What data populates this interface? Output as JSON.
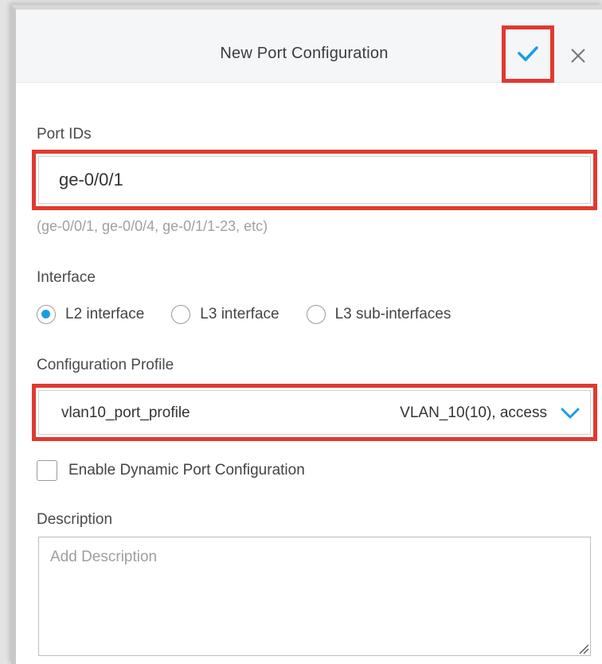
{
  "dialog": {
    "title": "New Port Configuration"
  },
  "port_ids": {
    "label": "Port IDs",
    "value": "ge-0/0/1",
    "hint": "(ge-0/0/1, ge-0/0/4, ge-0/1/1-23, etc)"
  },
  "interface": {
    "label": "Interface",
    "options": [
      {
        "label": "L2 interface",
        "selected": true
      },
      {
        "label": "L3 interface",
        "selected": false
      },
      {
        "label": "L3 sub-interfaces",
        "selected": false
      }
    ]
  },
  "profile": {
    "label": "Configuration Profile",
    "value": "vlan10_port_profile",
    "meta": "VLAN_10(10), access"
  },
  "dynamic": {
    "label": "Enable Dynamic Port Configuration",
    "checked": false
  },
  "description": {
    "label": "Description",
    "placeholder": "Add Description",
    "value": ""
  },
  "icons": {
    "confirm": "check-icon",
    "close": "close-icon",
    "chevron": "chevron-down-icon"
  },
  "colors": {
    "accent": "#1a9de0",
    "highlight": "#e03a2f",
    "header_bg": "#f4f6f8"
  }
}
